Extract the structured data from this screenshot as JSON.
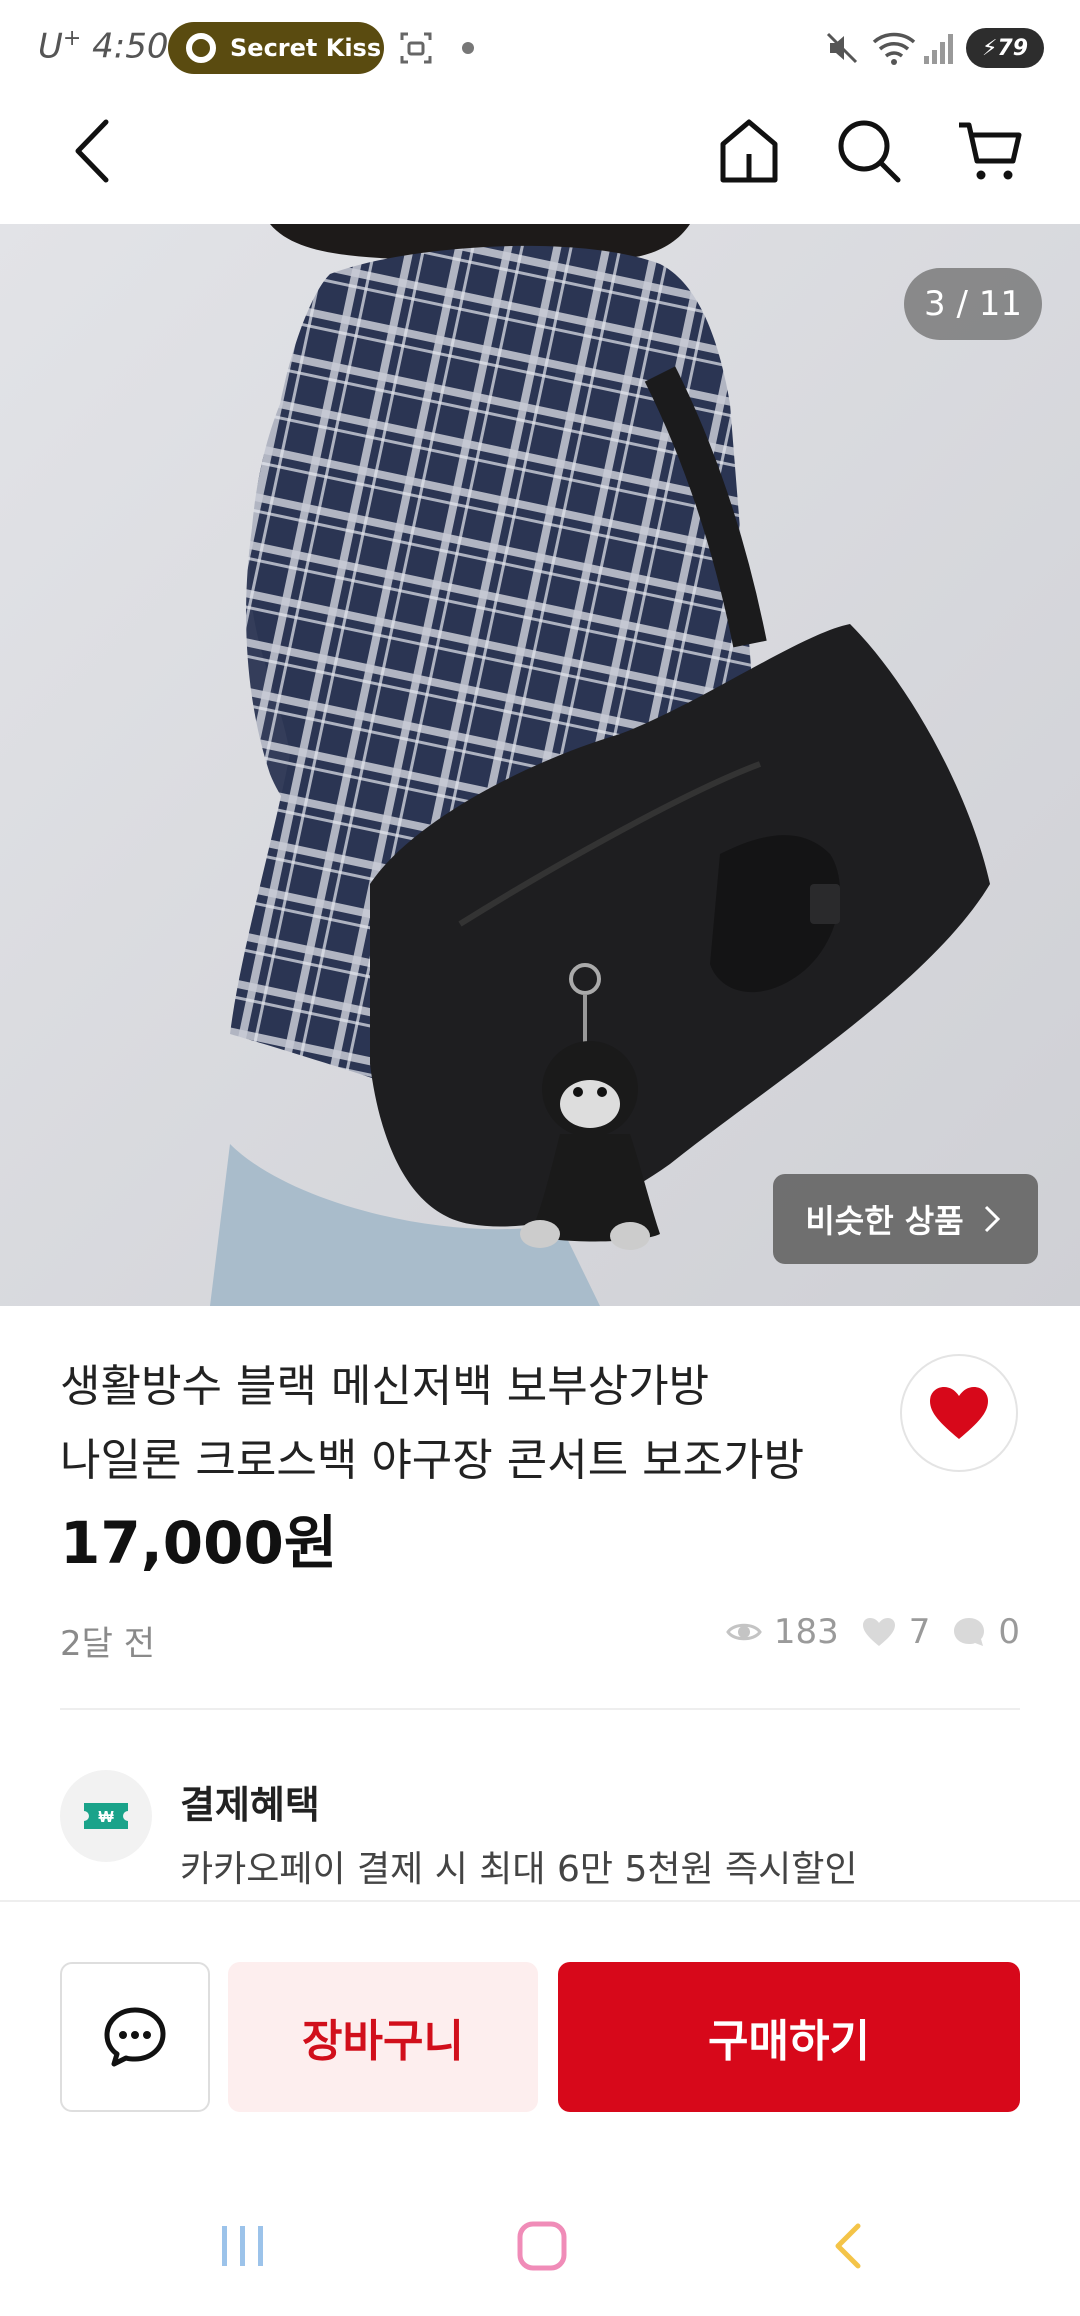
{
  "status_bar": {
    "carrier": "U",
    "carrier_sup": "+",
    "time": "4:50",
    "now_playing": "Secret Kiss",
    "battery": "79"
  },
  "nav": {
    "back_icon": "chevron-left-icon",
    "home_icon": "home-icon",
    "search_icon": "search-icon",
    "cart_icon": "cart-icon"
  },
  "gallery": {
    "counter": "3 / 11",
    "similar_label": "비슷한 상품"
  },
  "product": {
    "title_line1": "생활방수 블랙 메신저백 보부상가방",
    "title_line2": "나일론 크로스백 야구장 콘서트 보조가방",
    "price": "17,000원",
    "posted": "2달 전",
    "views": "183",
    "likes": "7",
    "comments": "0",
    "favorite_color": "#d7081a"
  },
  "benefit": {
    "title": "결제혜택",
    "description": "카카오페이 결제 시 최대 6만 5천원 즉시할인"
  },
  "actions": {
    "cart_label": "장바구니",
    "buy_label": "구매하기"
  },
  "colors": {
    "accent": "#d7081a",
    "accent_light": "#fdeeee"
  }
}
